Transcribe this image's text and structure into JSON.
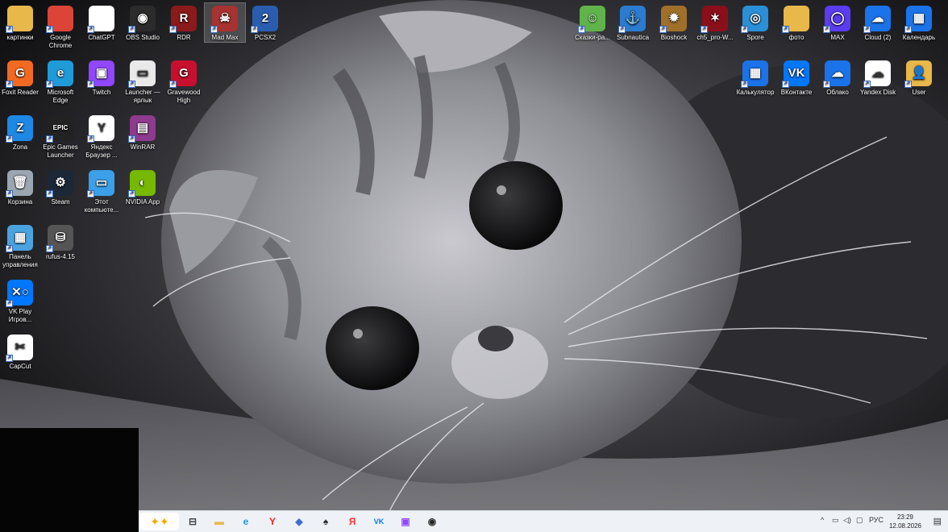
{
  "desktop": {
    "left_icons": [
      {
        "id": "kartinki",
        "label": "картинки",
        "icon": "folder-icon",
        "color": "#e8b84a",
        "glyph": ""
      },
      {
        "id": "chrome",
        "label": "Google Chrome",
        "icon": "chrome-icon",
        "color": "#db4437",
        "glyph": ""
      },
      {
        "id": "chatgpt",
        "label": "ChatGPT",
        "icon": "document-icon",
        "color": "#ffffff",
        "glyph": ""
      },
      {
        "id": "obs",
        "label": "OBS Studio",
        "icon": "obs-icon",
        "color": "#2b2b2b",
        "glyph": "◉"
      },
      {
        "id": "rdr",
        "label": "RDR",
        "icon": "rdr-icon",
        "color": "#8b1a1a",
        "glyph": "R"
      },
      {
        "id": "madmax",
        "label": "Mad Max",
        "icon": "skull-icon",
        "color": "#a83232",
        "glyph": "☠"
      },
      {
        "id": "pcsx2",
        "label": "PCSX2",
        "icon": "pcsx2-icon",
        "color": "#2a5db0",
        "glyph": "2"
      },
      {
        "id": "foxit",
        "label": "Foxit Reader",
        "icon": "foxit-icon",
        "color": "#f26a21",
        "glyph": "G"
      },
      {
        "id": "edge",
        "label": "Microsoft Edge",
        "icon": "edge-icon",
        "color": "#1f9bd8",
        "glyph": "e"
      },
      {
        "id": "twitch",
        "label": "Twitch",
        "icon": "twitch-icon",
        "color": "#9146ff",
        "glyph": "▣"
      },
      {
        "id": "launcher",
        "label": "Launcher — ярлык",
        "icon": "launcher-icon",
        "color": "#e9e9e9",
        "glyph": "▭"
      },
      {
        "id": "gravewood",
        "label": "Gravewood High",
        "icon": "gravewood-icon",
        "color": "#c8102e",
        "glyph": "G"
      },
      {
        "id": "zona",
        "label": "Zona",
        "icon": "zona-icon",
        "color": "#1e88e5",
        "glyph": "Z"
      },
      {
        "id": "epic",
        "label": "Epic Games Launcher",
        "icon": "epic-icon",
        "color": "#222222",
        "glyph": "EPIC"
      },
      {
        "id": "yandex-browser",
        "label": "Яндекс Браузер ...",
        "icon": "yandex-icon",
        "color": "#ffffff",
        "glyph": "Y"
      },
      {
        "id": "winrar",
        "label": "WinRAR",
        "icon": "winrar-icon",
        "color": "#8e3a8e",
        "glyph": "▤"
      },
      {
        "id": "trash",
        "label": "Корзина",
        "icon": "recycle-bin-icon",
        "color": "#9aa6b2",
        "glyph": "🗑"
      },
      {
        "id": "steam",
        "label": "Steam",
        "icon": "steam-icon",
        "color": "#1b2838",
        "glyph": "⚙"
      },
      {
        "id": "thispc",
        "label": "Этот компьюте...",
        "icon": "computer-icon",
        "color": "#3ba0e8",
        "glyph": "▭"
      },
      {
        "id": "nvidia",
        "label": "NVIDIA App",
        "icon": "nvidia-icon",
        "color": "#76b900",
        "glyph": "◐"
      },
      {
        "id": "panel",
        "label": "Панель управления",
        "icon": "control-panel-icon",
        "color": "#4aa3df",
        "glyph": "▦"
      },
      {
        "id": "rufus",
        "label": "rufus-4.15",
        "icon": "usb-drive-icon",
        "color": "#555555",
        "glyph": "⛁"
      },
      {
        "id": "vkplay",
        "label": "VK Play Игров...",
        "icon": "vkplay-icon",
        "color": "#0077ff",
        "glyph": "✕○"
      },
      {
        "id": "capcut",
        "label": "CapCut",
        "icon": "capcut-icon",
        "color": "#ffffff",
        "glyph": "✂"
      }
    ],
    "right_icons": [
      {
        "id": "skazki",
        "label": "Сказки-ра...",
        "icon": "game-icon",
        "color": "#5fb34a",
        "glyph": "☺"
      },
      {
        "id": "subnautica",
        "label": "Subnautica",
        "icon": "subnautica-icon",
        "color": "#2b7bd1",
        "glyph": "⚓"
      },
      {
        "id": "bioshock",
        "label": "Bioshock",
        "icon": "bioshock-icon",
        "color": "#a0702a",
        "glyph": "✹"
      },
      {
        "id": "ch5pro",
        "label": "ch5_pro-W...",
        "icon": "game-icon",
        "color": "#8b0f1a",
        "glyph": "✶"
      },
      {
        "id": "spore",
        "label": "Spore",
        "icon": "spore-icon",
        "color": "#2a8fd6",
        "glyph": "◎"
      },
      {
        "id": "foto",
        "label": "фото",
        "icon": "folder-icon",
        "color": "#e8b84a",
        "glyph": ""
      },
      {
        "id": "max",
        "label": "MAX",
        "icon": "max-icon",
        "color": "#5b3cf0",
        "glyph": "◯"
      },
      {
        "id": "cloud2",
        "label": "Cloud (2)",
        "icon": "cloud-icon",
        "color": "#1a73e8",
        "glyph": "☁"
      },
      {
        "id": "calendar",
        "label": "Календарь",
        "icon": "calendar-icon",
        "color": "#1a73e8",
        "glyph": "▦"
      },
      {
        "id": "calculator",
        "label": "Калькулятор",
        "icon": "calculator-icon",
        "color": "#1a73e8",
        "glyph": "▦"
      },
      {
        "id": "vk",
        "label": "ВКонтакте",
        "icon": "vk-icon",
        "color": "#0077ff",
        "glyph": "VK"
      },
      {
        "id": "oblako",
        "label": "Облако",
        "icon": "cloud-icon",
        "color": "#1a73e8",
        "glyph": "☁"
      },
      {
        "id": "yadisk",
        "label": "Yandex Disk",
        "icon": "yandex-disk-icon",
        "color": "#ffffff",
        "glyph": "☁"
      },
      {
        "id": "user",
        "label": "User",
        "icon": "user-folder-icon",
        "color": "#e8b84a",
        "glyph": "👤"
      }
    ]
  },
  "taskbar": {
    "apps": [
      {
        "id": "task-view",
        "icon": "task-view-icon",
        "glyph": "⊟",
        "color": "#444444"
      },
      {
        "id": "explorer",
        "icon": "file-explorer-icon",
        "glyph": "▬",
        "color": "#e8b84a"
      },
      {
        "id": "edge",
        "icon": "edge-icon",
        "glyph": "e",
        "color": "#1f9bd8"
      },
      {
        "id": "yandex",
        "icon": "yandex-icon",
        "glyph": "Y",
        "color": "#ff1f1f"
      },
      {
        "id": "store",
        "icon": "store-icon",
        "glyph": "◆",
        "color": "#3e6fd0"
      },
      {
        "id": "solitaire",
        "icon": "cards-icon",
        "glyph": "♠",
        "color": "#2d2d2d"
      },
      {
        "id": "yabrowser",
        "icon": "yandex-browser-icon",
        "glyph": "Я",
        "color": "#ff3333"
      },
      {
        "id": "vk",
        "icon": "vk-icon",
        "glyph": "VK",
        "color": "#0077ff"
      },
      {
        "id": "twitch",
        "icon": "twitch-icon",
        "glyph": "▣",
        "color": "#9146ff"
      },
      {
        "id": "obs",
        "icon": "obs-icon",
        "glyph": "◉",
        "color": "#2b2b2b"
      }
    ],
    "tray": {
      "language": "РУС",
      "time": "23:29",
      "date": "12.08.2026"
    }
  }
}
